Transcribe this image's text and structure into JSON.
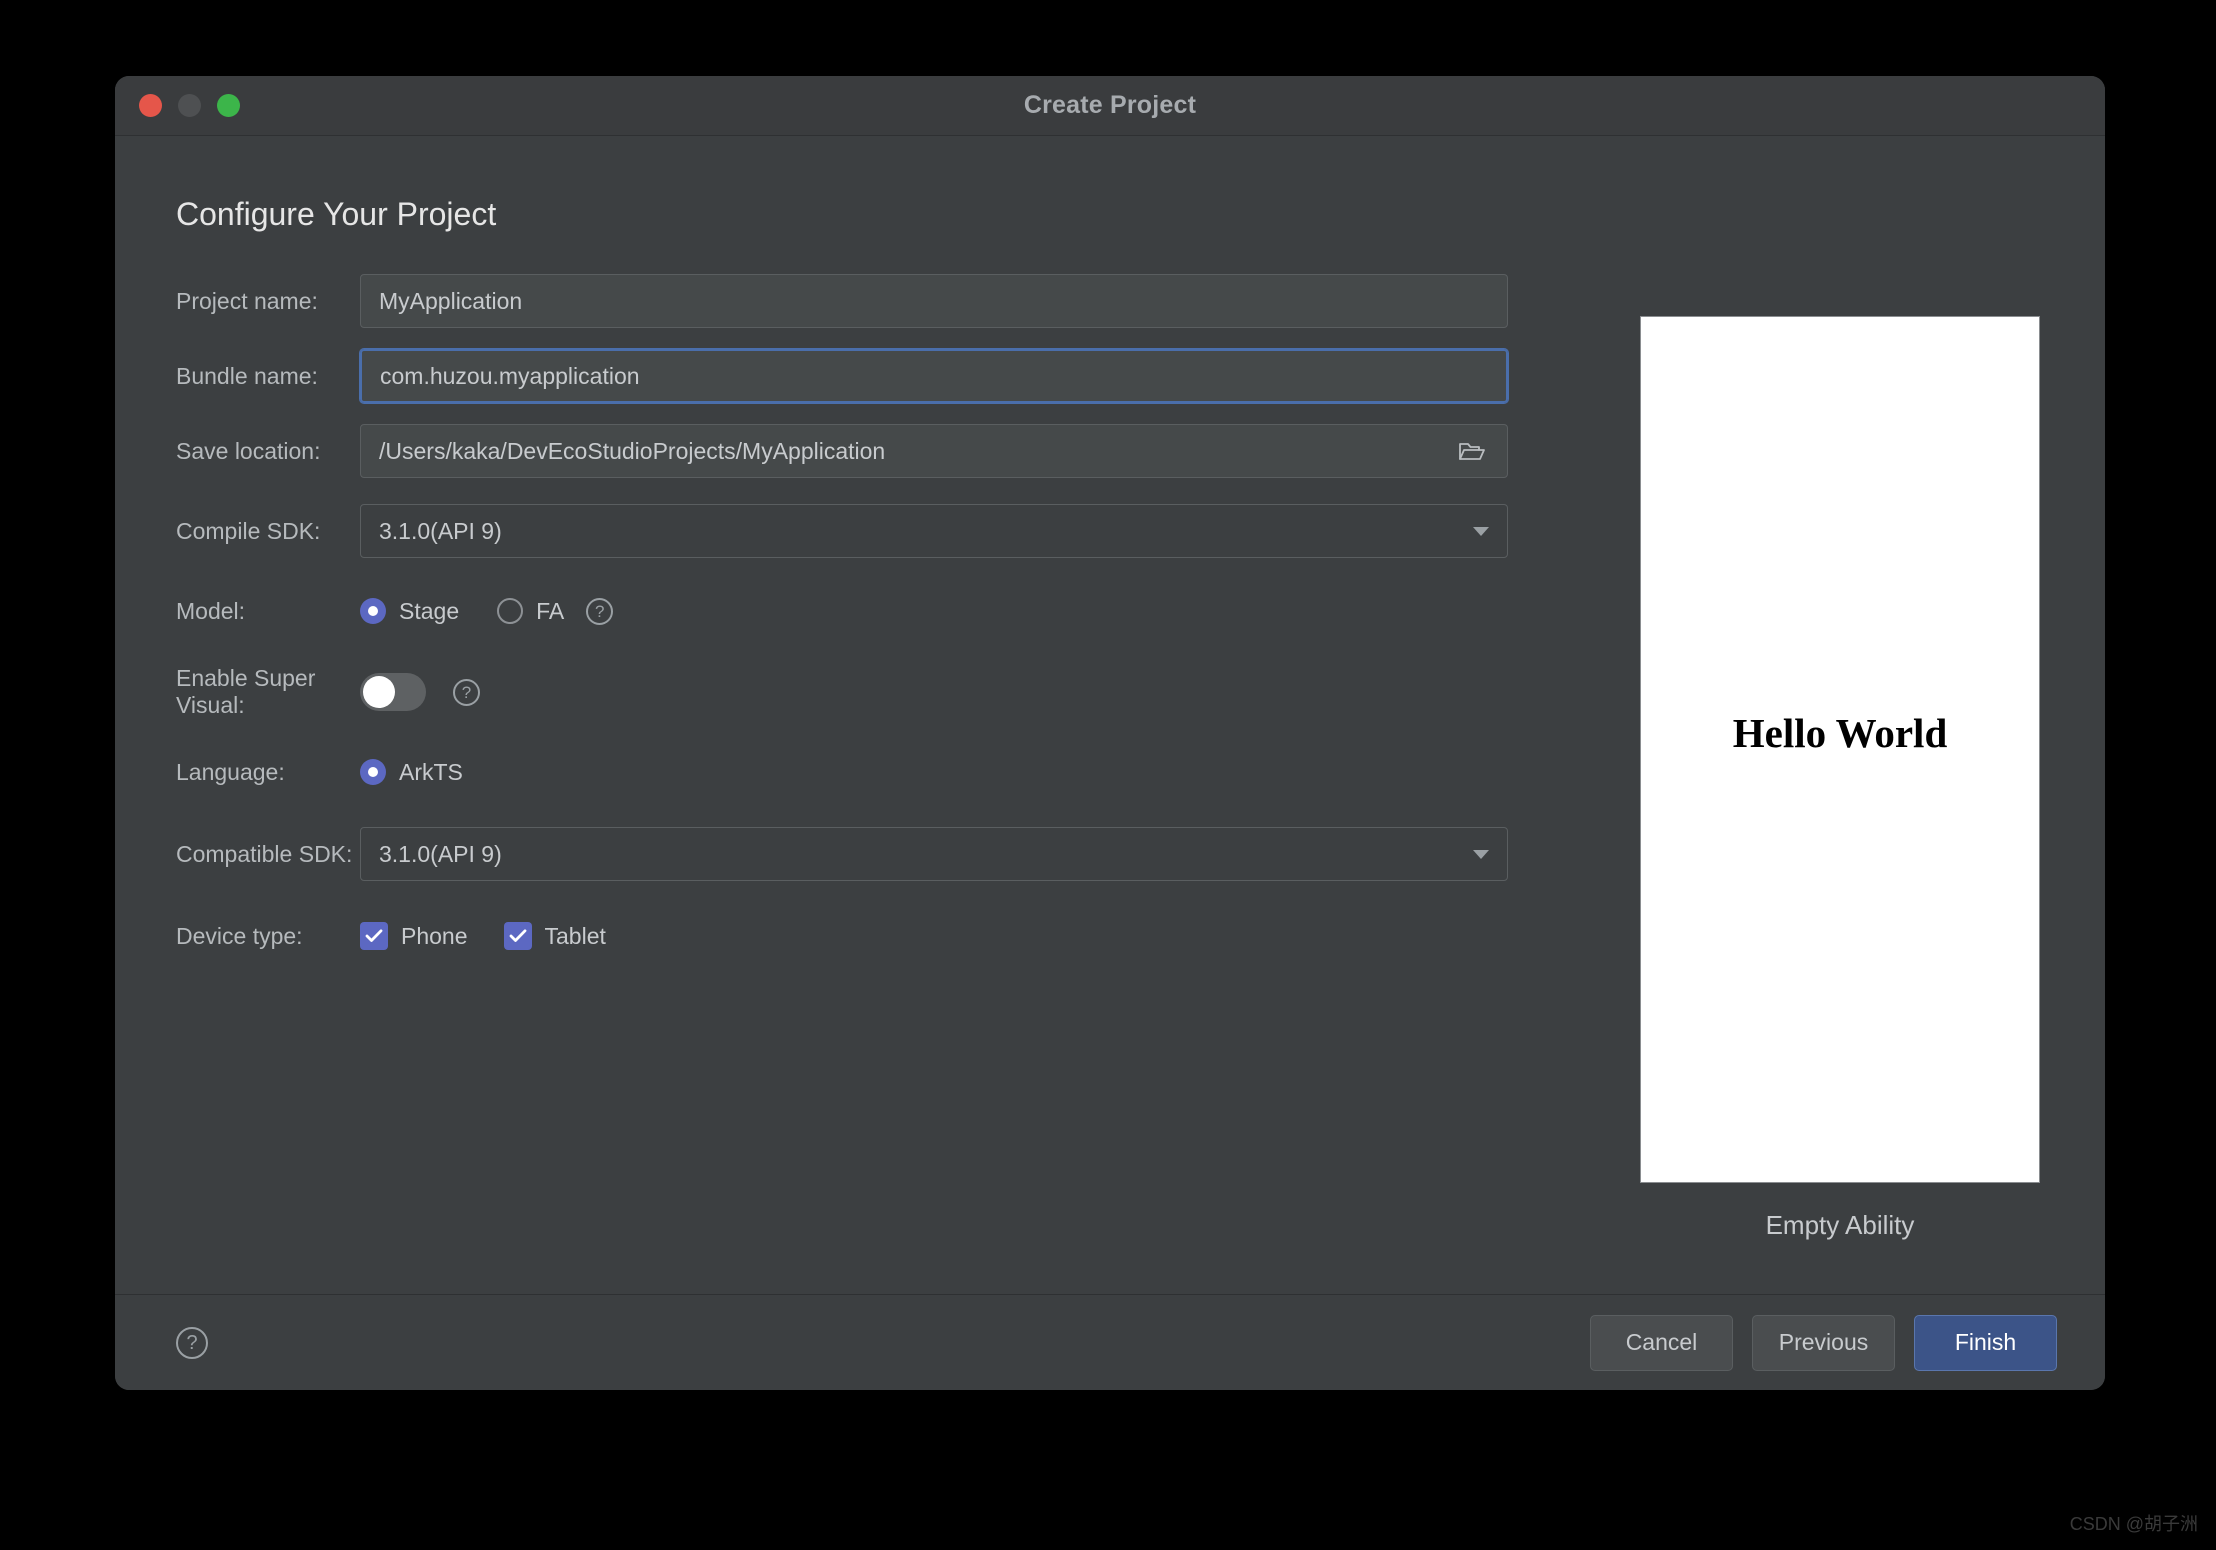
{
  "window": {
    "title": "Create Project",
    "traffic_lights": [
      "close-button",
      "minimize-button",
      "maximize-button"
    ]
  },
  "page_title": "Configure Your Project",
  "form": {
    "project_name": {
      "label": "Project name:",
      "value": "MyApplication",
      "focused": false
    },
    "bundle_name": {
      "label": "Bundle name:",
      "value": "com.huzou.myapplication",
      "focused": true
    },
    "save_location": {
      "label": "Save location:",
      "value": "/Users/kaka/DevEcoStudioProjects/MyApplication",
      "browse_icon": "folder-open-icon"
    },
    "compile_sdk": {
      "label": "Compile SDK:",
      "value": "3.1.0(API 9)"
    },
    "model": {
      "label": "Model:",
      "options": [
        {
          "label": "Stage",
          "selected": true
        },
        {
          "label": "FA",
          "selected": false
        }
      ],
      "help_icon": "help-circle-icon"
    },
    "enable_super_visual": {
      "label": "Enable Super Visual:",
      "enabled": false,
      "help_icon": "help-circle-icon"
    },
    "language": {
      "label": "Language:",
      "options": [
        {
          "label": "ArkTS",
          "selected": true
        }
      ]
    },
    "compatible_sdk": {
      "label": "Compatible SDK:",
      "value": "3.1.0(API 9)"
    },
    "device_type": {
      "label": "Device type:",
      "options": [
        {
          "label": "Phone",
          "checked": true
        },
        {
          "label": "Tablet",
          "checked": true
        }
      ]
    }
  },
  "preview": {
    "screen_text": "Hello World",
    "caption": "Empty Ability"
  },
  "footer": {
    "help_icon": "help-circle-icon",
    "cancel_label": "Cancel",
    "previous_label": "Previous",
    "finish_label": "Finish"
  },
  "watermark": "CSDN @胡子洲",
  "colors": {
    "window_bg": "#3c3f41",
    "titlebar_bg": "#3a3c3e",
    "accent": "#5c68c2",
    "primary_button": "#3c5488",
    "focus_border": "#4a6eab",
    "close_red": "#e5564a",
    "maximize_green": "#3cb54a"
  }
}
